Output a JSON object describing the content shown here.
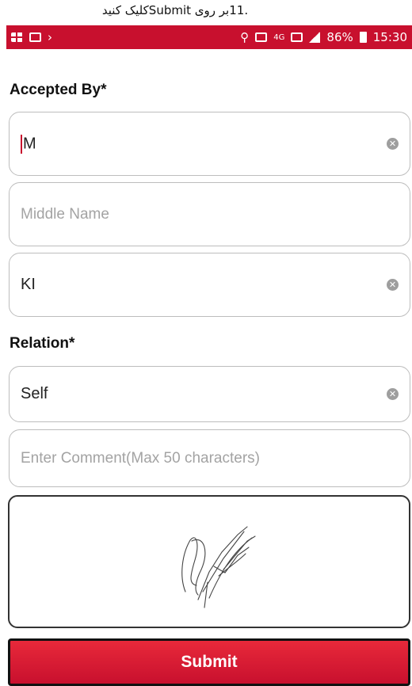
{
  "caption": ".11بر روی  Submitکلیک کنید",
  "status_bar": {
    "network_label": "4G",
    "battery": "86%",
    "time": "15:30"
  },
  "form": {
    "accepted_by_label": "Accepted By*",
    "first_name_value": "M",
    "middle_name_placeholder": "Middle Name",
    "last_name_value": "KI",
    "relation_label": "Relation*",
    "relation_value": "Self",
    "comment_placeholder": "Enter Comment(Max 50 characters)"
  },
  "submit_label": "Submit",
  "colors": {
    "accent": "#c8102e",
    "border": "#bdbdbd",
    "placeholder": "#a3a3a3"
  },
  "icons": [
    "gallery-icon",
    "message-icon",
    "location-icon",
    "sim-icon",
    "signal-icon",
    "battery-icon",
    "clear-icon"
  ]
}
